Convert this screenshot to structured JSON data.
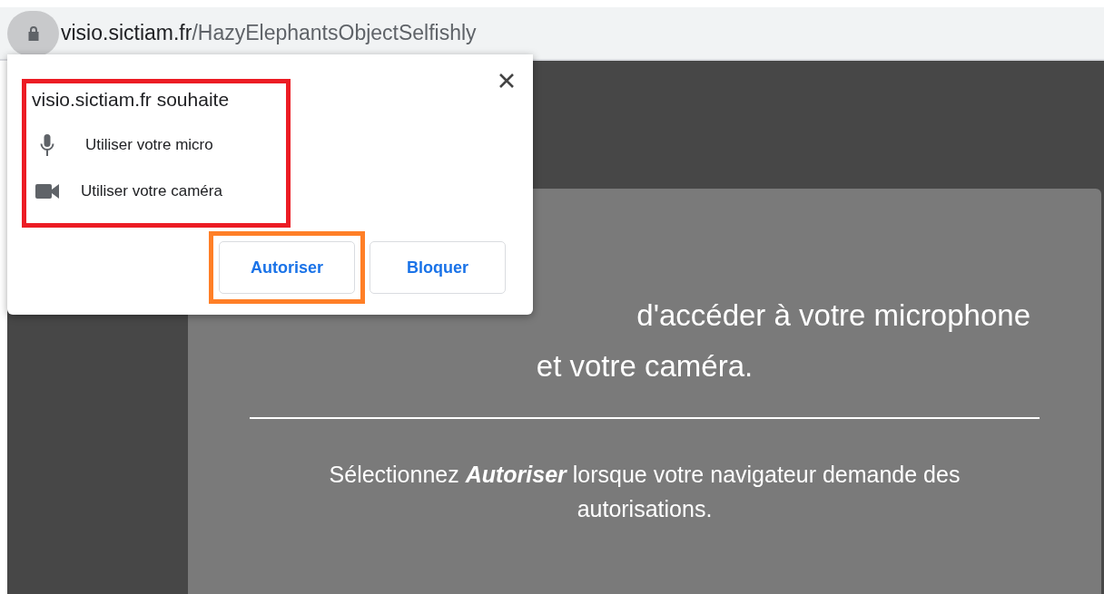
{
  "address_bar": {
    "domain": "visio.sictiam.fr",
    "path": "/HazyElephantsObjectSelfishly"
  },
  "permission_popup": {
    "heading": "visio.sictiam.fr souhaite",
    "permissions": [
      {
        "kind": "microphone",
        "label": "Utiliser votre micro"
      },
      {
        "kind": "camera",
        "label": "Utiliser votre caméra"
      }
    ],
    "buttons": [
      {
        "label": "Autoriser",
        "highlighted": true
      },
      {
        "label": "Bloquer",
        "highlighted": false
      }
    ]
  },
  "card": {
    "heading_lines": [
      "d'accéder à votre microphone",
      "et votre caméra."
    ],
    "instruction": "Sélectionnez **Autoriser** lorsque votre navigateur demande des autorisations."
  }
}
